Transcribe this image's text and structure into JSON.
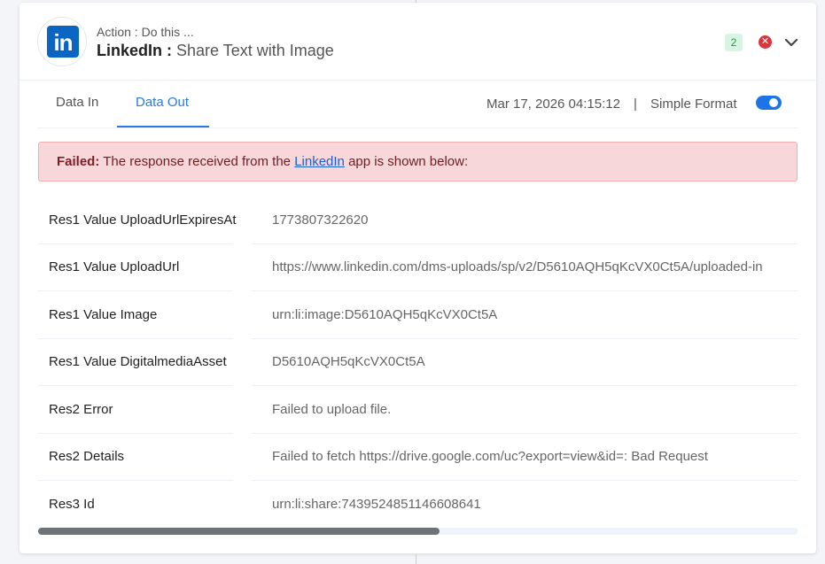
{
  "header": {
    "action_label": "Action : Do this ...",
    "app_name": "LinkedIn :",
    "action_name": " Share Text with Image",
    "logo_text": "in",
    "badge_count": "2",
    "close_icon": "close-icon",
    "chevron_icon": "chevron-down-icon"
  },
  "tabs": {
    "data_in": "Data In",
    "data_out": "Data Out",
    "active": "data_out"
  },
  "meta": {
    "timestamp": "Mar 17, 2026 04:15:12",
    "separator": "|",
    "format_label": "Simple Format",
    "simple_format_on": true
  },
  "alert": {
    "strong": "Failed:",
    "text_before": " The response received from the ",
    "link": "LinkedIn",
    "text_after": " app is shown below:"
  },
  "rows": [
    {
      "key": "Res1 Value UploadUrlExpiresAt",
      "value": "1773807322620"
    },
    {
      "key": "Res1 Value UploadUrl",
      "value": "https://www.linkedin.com/dms-uploads/sp/v2/D5610AQH5qKcVX0Ct5A/uploaded-in"
    },
    {
      "key": "Res1 Value Image",
      "value": "urn:li:image:D5610AQH5qKcVX0Ct5A"
    },
    {
      "key": "Res1 Value DigitalmediaAsset",
      "value": "D5610AQH5qKcVX0Ct5A"
    },
    {
      "key": "Res2 Error",
      "value": "Failed to upload file."
    },
    {
      "key": "Res2 Details",
      "value": "Failed to fetch https://drive.google.com/uc?export=view&id=: Bad Request"
    },
    {
      "key": "Res3 Id",
      "value": "urn:li:share:7439524851146608641"
    }
  ],
  "colors": {
    "accent": "#2a7ae2",
    "linkedin": "#0a66c2",
    "error_bg": "#f8d7da",
    "badge_bg": "#d7f5e3",
    "close": "#d9363e"
  }
}
